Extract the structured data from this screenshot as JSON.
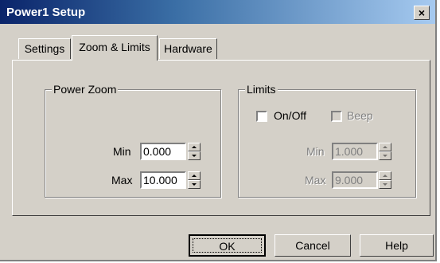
{
  "window": {
    "title": "Power1 Setup",
    "close_glyph": "×"
  },
  "tabs": [
    {
      "label": "Settings",
      "active": false
    },
    {
      "label": "Zoom & Limits",
      "active": true
    },
    {
      "label": "Hardware",
      "active": false
    }
  ],
  "power_zoom": {
    "legend": "Power Zoom",
    "min_label": "Min",
    "min_value": "0.000",
    "max_label": "Max",
    "max_value": "10.000"
  },
  "limits": {
    "legend": "Limits",
    "onoff_label": "On/Off",
    "onoff_checked": false,
    "beep_label": "Beep",
    "beep_checked": false,
    "min_label": "Min",
    "min_value": "1.000",
    "max_label": "Max",
    "max_value": "9.000"
  },
  "buttons": {
    "ok": "OK",
    "cancel": "Cancel",
    "help": "Help"
  }
}
